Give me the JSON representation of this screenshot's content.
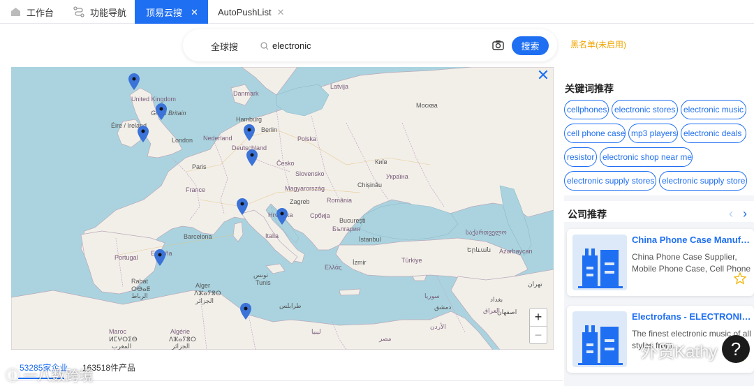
{
  "tabs": [
    {
      "label": "工作台",
      "icon": "home-icon"
    },
    {
      "label": "功能导航",
      "icon": "navigation-icon"
    },
    {
      "label": "顶易云搜",
      "icon": "",
      "active": true,
      "close": "✕"
    },
    {
      "label": "AutoPushList",
      "icon": "",
      "close": "✕"
    }
  ],
  "search": {
    "scope": "全球搜",
    "query": "electronic",
    "button": "搜索",
    "blacklist": "黑名单(未启用)"
  },
  "map": {
    "close": "✕",
    "zoom_in": "+",
    "zoom_out": "−",
    "labels": {
      "united_kingdom": "United Kingdom",
      "great_britain": "Great Britain",
      "eire": "Éire / Ireland",
      "london": "London",
      "danmark": "Danmark",
      "latvija": "Latvija",
      "moskva": "Москва",
      "hamburg": "Hamburg",
      "berlin": "Berlin",
      "polska": "Polska",
      "nederland": "Nederland",
      "deutschland": "Deutschland",
      "paris": "Paris",
      "cesko": "Česko",
      "kyiv": "Київ",
      "slovensko": "Slovensko",
      "ukraina": "Україна",
      "france": "France",
      "magyarorszag": "Magyarország",
      "chisinau": "Chișinău",
      "zagreb": "Zagreb",
      "romania": "România",
      "hrvatska": "Hrvatska",
      "srbija": "Србија",
      "bucuresti": "București",
      "balgariya": "България",
      "barcelona": "Barcelona",
      "italia": "Italia",
      "istanbul": "İstanbul",
      "sakartvelo": "საქართველო",
      "yerevan": "Երևան",
      "azarbaycan": "Azərbaycan",
      "portugal": "Portugal",
      "espana": "España",
      "ellada": "Ελλάς",
      "izmir": "İzmir",
      "turkiye": "Türkiye",
      "rabat": "Rabat",
      "rabat_tif": "ⵔⴱⴰⵟ",
      "rabat_ar": "الرباط",
      "alger": "Alger",
      "alger_tif": "ⴷⵣⴰⵢⴻⵔ",
      "alger_ar": "الجزائر",
      "tunis": "تونس",
      "tunis_fr": "Tunis",
      "tripoli": "طرابلس",
      "suriya": "سوريا",
      "baghdad": "بغداد",
      "dimashq": "دمشق",
      "iraq": "العراق",
      "tehran": "تهران",
      "esfahan": "اصفهان",
      "ardun": "الأردن",
      "maroc": "Maroc",
      "maroc_tif": "ⵍⵎⵖⵔⵉⴱ",
      "maroc_ar": "المغرب",
      "algerie": "Algérie",
      "algerie_tif": "ⴷⵣⴰⵢⴻⵔ",
      "algerie_ar": "الجزائر",
      "libya": "ليبيا",
      "misr": "مصر"
    }
  },
  "stats": {
    "companies": "53285家企业",
    "products": "163518件产品"
  },
  "keywords": {
    "title": "关键词推荐",
    "items": [
      "cellphones",
      "electronic stores",
      "electronic music",
      "cell phone case",
      "mp3 players",
      "electronic deals",
      "resistor",
      "electronic shop near me",
      "electronic supply stores",
      "electronic supply store"
    ]
  },
  "companies": {
    "title": "公司推荐",
    "prev": "‹",
    "next": "›",
    "items": [
      {
        "name": "China Phone Case Manufac…",
        "desc": "China Phone Case Supplier, Mobile Phone Case, Cell Phone C…"
      },
      {
        "name": "Electrofans - ELECTRONIC …",
        "desc": "The finest electronic music of all styles from…"
      }
    ]
  },
  "watermarks": {
    "left": "ⓘ 一八数跨境",
    "right": "外贸Kathy"
  },
  "colors": {
    "accent": "#1f6ff2",
    "blacklist": "#f0a500",
    "sea": "#aad3df",
    "land": "#f2efe9"
  }
}
